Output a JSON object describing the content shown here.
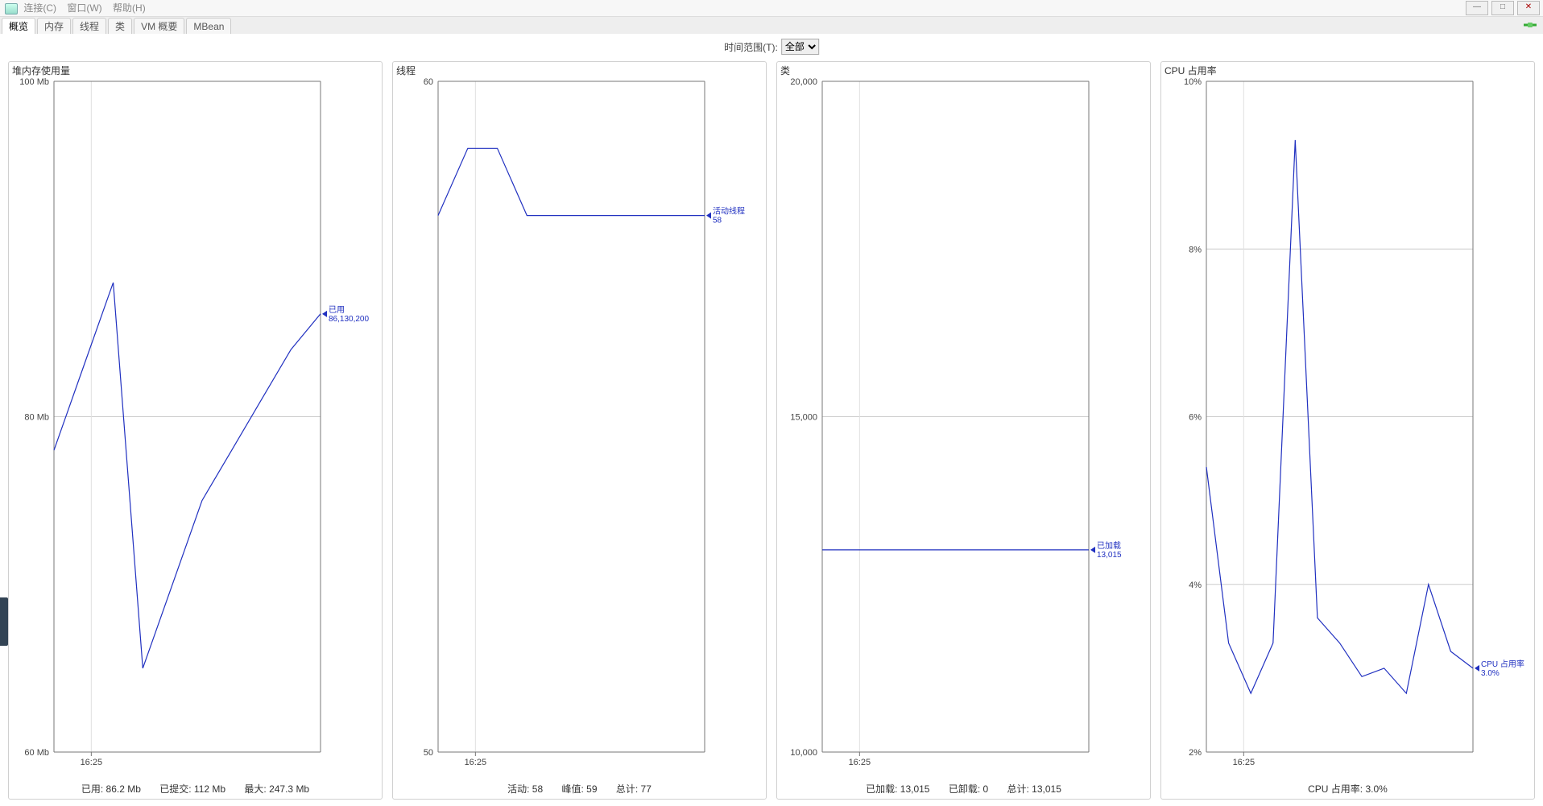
{
  "window": {
    "menu": {
      "connect": "连接(C)",
      "window": "窗口(W)",
      "help": "帮助(H)"
    },
    "controls": {
      "minimize": "—",
      "maximize": "□",
      "close": "✕"
    }
  },
  "tabs": [
    {
      "id": "overview",
      "label": "概览",
      "active": true
    },
    {
      "id": "memory",
      "label": "内存",
      "active": false
    },
    {
      "id": "threads",
      "label": "线程",
      "active": false
    },
    {
      "id": "classes",
      "label": "类",
      "active": false
    },
    {
      "id": "vm",
      "label": "VM 概要",
      "active": false
    },
    {
      "id": "mbean",
      "label": "MBean",
      "active": false
    }
  ],
  "timeRange": {
    "label": "时间范围(T):",
    "selected": "全部",
    "options": [
      "全部"
    ]
  },
  "charts": {
    "heap": {
      "title": "堆内存使用量",
      "series_name": "已用",
      "end_value_label": "86,130,200",
      "stats": {
        "used": "已用:  86.2  Mb",
        "committed": "已提交:  112  Mb",
        "max": "最大:  247.3  Mb"
      }
    },
    "threads": {
      "title": "线程",
      "series_name": "活动线程",
      "end_value_label": "58",
      "stats": {
        "live": "活动:  58",
        "peak": "峰值:  59",
        "total": "总计:  77"
      }
    },
    "classes": {
      "title": "类",
      "series_name": "已加载",
      "end_value_label": "13,015",
      "stats": {
        "loaded": "已加载:  13,015",
        "unloaded": "已卸载:  0",
        "total": "总计:  13,015"
      }
    },
    "cpu": {
      "title": "CPU 占用率",
      "series_name": "CPU 占用率",
      "end_value_label": "3.0%",
      "stats": {
        "usage": "CPU 占用率:  3.0%"
      }
    }
  },
  "chart_data": [
    {
      "id": "heap",
      "type": "line",
      "title": "堆内存使用量",
      "xlabel": "",
      "ylabel": "Mb",
      "ylim": [
        60,
        100
      ],
      "yticks": [
        60,
        80,
        100
      ],
      "xticks": [
        "16:25"
      ],
      "x": [
        0,
        1,
        2,
        3,
        4,
        5,
        6,
        7,
        8,
        9
      ],
      "series": [
        {
          "name": "已用",
          "values": [
            78,
            83,
            88,
            65,
            70,
            75,
            78,
            81,
            84,
            86.13
          ]
        }
      ]
    },
    {
      "id": "threads",
      "type": "line",
      "title": "线程",
      "xlabel": "",
      "ylabel": "",
      "ylim": [
        50,
        60
      ],
      "yticks": [
        50,
        60
      ],
      "xticks": [
        "16:25"
      ],
      "x": [
        0,
        1,
        2,
        3,
        4,
        5,
        6,
        7,
        8,
        9
      ],
      "series": [
        {
          "name": "活动线程",
          "values": [
            58,
            59,
            59,
            58,
            58,
            58,
            58,
            58,
            58,
            58
          ]
        }
      ]
    },
    {
      "id": "classes",
      "type": "line",
      "title": "类",
      "xlabel": "",
      "ylabel": "",
      "ylim": [
        10000,
        20000
      ],
      "yticks": [
        10000,
        15000,
        20000
      ],
      "xticks": [
        "16:25"
      ],
      "x": [
        0,
        1,
        2,
        3,
        4,
        5,
        6,
        7,
        8,
        9
      ],
      "series": [
        {
          "name": "已加载",
          "values": [
            13015,
            13015,
            13015,
            13015,
            13015,
            13015,
            13015,
            13015,
            13015,
            13015
          ]
        }
      ]
    },
    {
      "id": "cpu",
      "type": "line",
      "title": "CPU 占用率",
      "xlabel": "",
      "ylabel": "%",
      "ylim": [
        2,
        10
      ],
      "yticks": [
        2,
        4,
        6,
        8,
        10
      ],
      "xticks": [
        "16:25"
      ],
      "x": [
        0,
        1,
        2,
        3,
        4,
        5,
        6,
        7,
        8,
        9,
        10,
        11,
        12
      ],
      "series": [
        {
          "name": "CPU 占用率",
          "values": [
            5.4,
            3.3,
            2.7,
            3.3,
            9.3,
            3.6,
            3.3,
            2.9,
            3.0,
            2.7,
            4.0,
            3.2,
            3.0
          ]
        }
      ]
    }
  ]
}
